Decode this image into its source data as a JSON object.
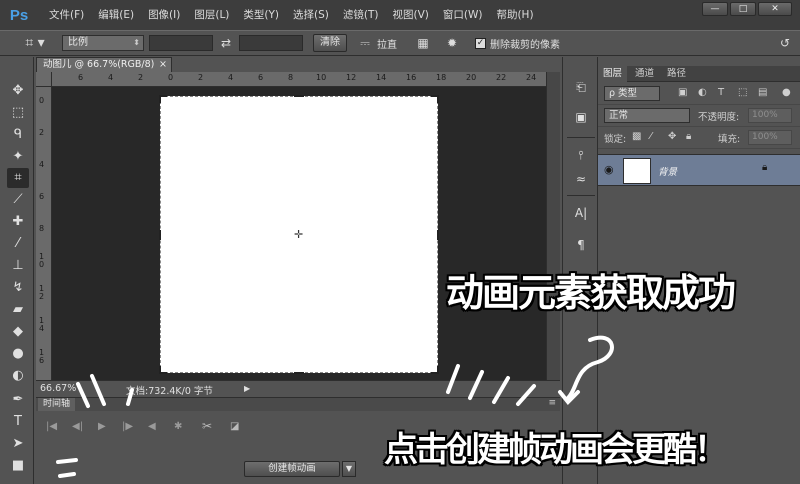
{
  "menubar": {
    "logo": "Ps",
    "items": [
      "文件(F)",
      "编辑(E)",
      "图像(I)",
      "图层(L)",
      "类型(Y)",
      "选择(S)",
      "滤镜(T)",
      "视图(V)",
      "窗口(W)",
      "帮助(H)"
    ],
    "window_controls": [
      "—",
      "□",
      "✕"
    ]
  },
  "optionsbar": {
    "ratio_select": "比例",
    "swap_icon": "⇄",
    "clear_button": "清除",
    "straighten_label": "拉直",
    "delete_pixels_checked": "✓",
    "delete_pixels_label": "删除裁剪的像素",
    "reset_icon": "↺"
  },
  "document": {
    "tab_title": "动图儿 @ 66.7%(RGB/8)",
    "tab_close": "×",
    "ruler_h": [
      "6",
      "4",
      "2",
      "0",
      "2",
      "4",
      "6",
      "8",
      "10",
      "12",
      "14",
      "16",
      "18",
      "20",
      "22",
      "24"
    ],
    "ruler_v": [
      "0",
      "2",
      "4",
      "6",
      "8",
      "1 0",
      "1 2",
      "1 4",
      "1 6"
    ],
    "zoom": "66.67%",
    "doc_info": "文档:732.4K/0 字节"
  },
  "timeline": {
    "tab": "时间轴",
    "create_button": "创建帧动画",
    "controls": [
      "|◀",
      "◀|",
      "▶",
      "|▶",
      "◀",
      "✱",
      "✂",
      "◪"
    ]
  },
  "layers": {
    "tabs": [
      "图层",
      "通道",
      "路径"
    ],
    "kind_filter": "ρ 类型",
    "blend_mode": "正常",
    "opacity_label": "不透明度:",
    "opacity_value": "100%",
    "lock_label": "锁定:",
    "fill_label": "填充:",
    "fill_value": "100%",
    "layer_name": "背景"
  },
  "annotations": {
    "line1": "动画元素获取成功",
    "line2": "点击创建帧动画会更酷！"
  }
}
